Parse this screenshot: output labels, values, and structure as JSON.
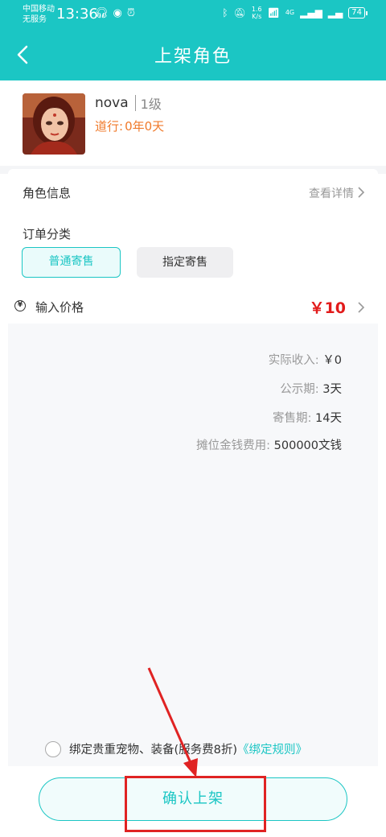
{
  "status_bar": {
    "carrier_line1": "中国移动",
    "carrier_line2": "无服务",
    "time": "13:36",
    "net_speed_value": "1.6",
    "net_speed_unit": "K/s",
    "signal_label": "4G",
    "battery": "74"
  },
  "header": {
    "title": "上架角色"
  },
  "character": {
    "name": "nova",
    "level": "1级",
    "daoxing_label": "道行:",
    "daoxing_value": "0年0天"
  },
  "role_info": {
    "label": "角色信息",
    "detail_link": "查看详情"
  },
  "order": {
    "label": "订单分类",
    "options": [
      "普通寄售",
      "指定寄售"
    ],
    "selected": "普通寄售"
  },
  "price": {
    "label": "输入价格",
    "value": "￥10"
  },
  "summary": [
    {
      "key": "实际收入:",
      "value": "￥0"
    },
    {
      "key": "公示期:",
      "value": "3天"
    },
    {
      "key": "寄售期:",
      "value": "14天"
    },
    {
      "key": "摊位金钱费用:",
      "value": "500000文钱"
    }
  ],
  "bind": {
    "text": "绑定贵重宠物、装备(服务费8折)",
    "link": "《绑定规则》"
  },
  "confirm": {
    "label": "确认上架"
  },
  "colors": {
    "accent": "#1bc6c4",
    "price": "#e21b1b",
    "daoxing": "#f07a2b",
    "annotation": "#e02323"
  }
}
